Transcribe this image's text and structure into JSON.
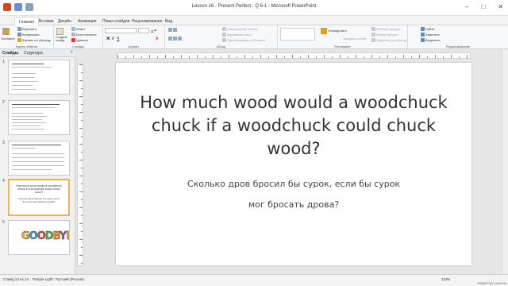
{
  "window": {
    "title": "Lesson 16 - Present Perfect - Q 6-1 - Microsoft PowerPoint",
    "controls": [
      "–",
      "□",
      "✕"
    ]
  },
  "tabs": [
    {
      "label": "Главная",
      "active": true
    },
    {
      "label": "Вставка"
    },
    {
      "label": "Дизайн"
    },
    {
      "label": "Анимация"
    },
    {
      "label": "Показ слайдов"
    },
    {
      "label": "Рецензирование"
    },
    {
      "label": "Вид"
    }
  ],
  "ribbon": {
    "paste": "Вставить",
    "cut": "Вырезать",
    "copy": "Копировать",
    "format_painter": "Формат по образцу",
    "clipboard_caption": "Буфер обмена",
    "new_slide": "Создать слайд",
    "layout": "Макет",
    "reset": "Восстановить",
    "delete": "Удалить",
    "slides_caption": "Слайды",
    "font_caption": "Шрифт",
    "text_direction": "Направление текста",
    "align_text": "Выровнять текст",
    "convert_smartart": "Преобразовать в SmartArt",
    "paragraph_caption": "Абзац",
    "arrange": "Упорядочить",
    "quick_styles": "Экспресс-стили",
    "fill": "Заливка фигуры",
    "outline": "Контур фигуры",
    "effects": "Эффекты для фигур",
    "drawing_caption": "Рисование",
    "find": "Найти",
    "replace": "Заменить",
    "select": "Выделить",
    "editing_caption": "Редактирование"
  },
  "pane": {
    "tab_slides": "Слайды",
    "tab_outline": "Структура",
    "close": "×"
  },
  "thumbs": [
    {
      "num": "1"
    },
    {
      "num": "2"
    },
    {
      "num": "3"
    },
    {
      "num": "4",
      "title": "How much wood would a woodchuck chuck if a woodchuck could chuck wood?",
      "sub": "Сколько дров бросил бы сурок, если бы сурок мог бросать дрова?"
    },
    {
      "num": "5",
      "goodbye": "GOODBYE"
    }
  ],
  "slide": {
    "title": "How much wood would a woodchuck chuck if a woodchuck could chuck wood?",
    "sub1": "Сколько дров бросил бы сурок, если бы сурок",
    "sub2": "мог бросать дрова?"
  },
  "status": {
    "slide_num": "Слайд 13 из 14",
    "theme": "\"Simple Light\"",
    "language": "Русский (Россия)",
    "zoom": "113%",
    "clock": "2025/07/21 14:09:00"
  }
}
